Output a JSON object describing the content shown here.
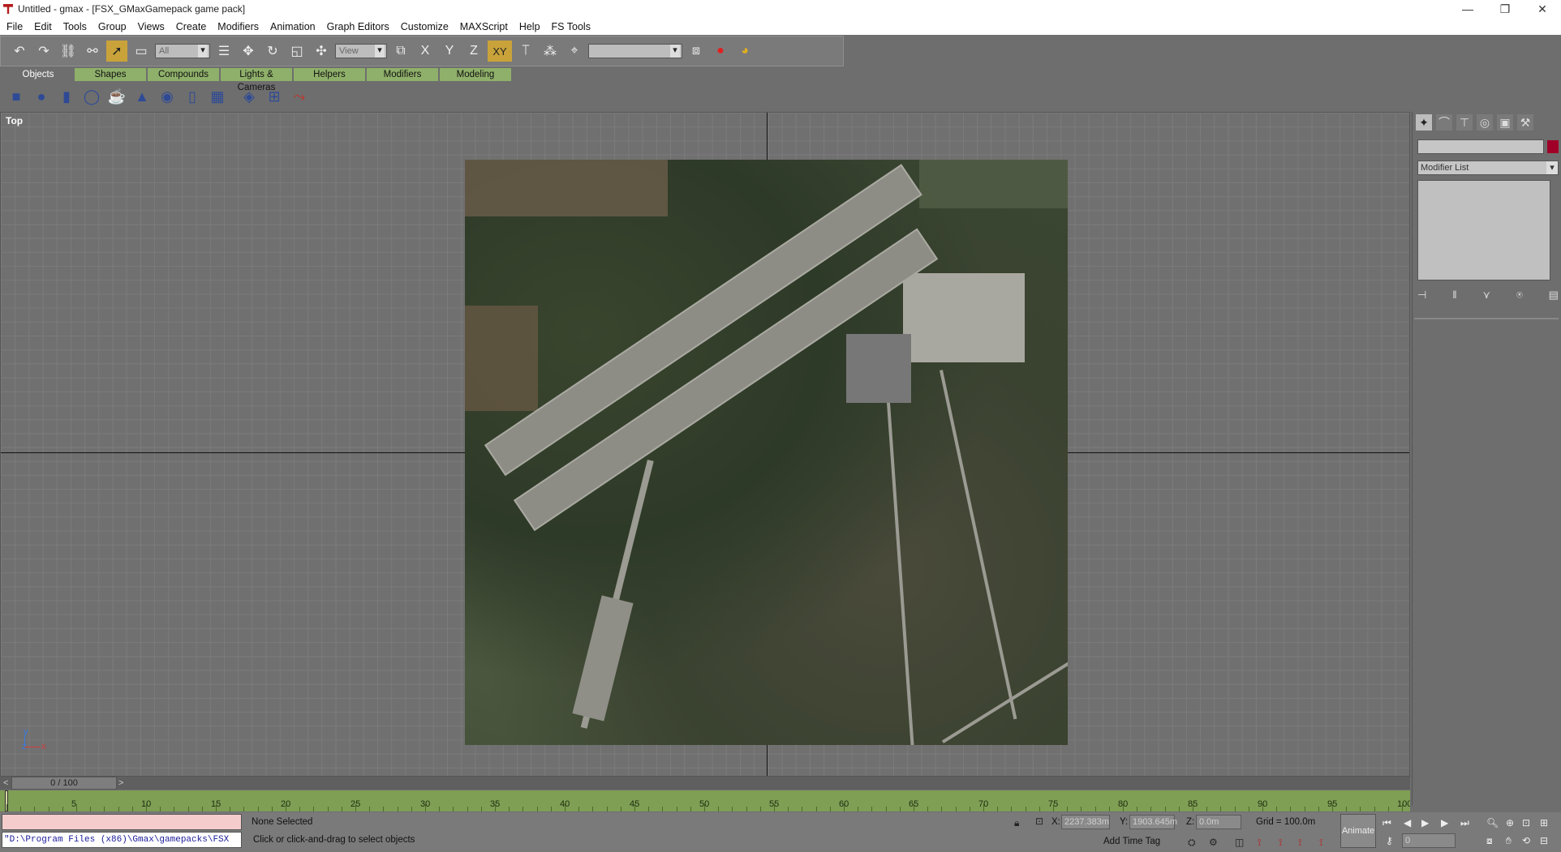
{
  "window": {
    "title": "Untitled - gmax - [FSX_GMaxGamepack game pack]",
    "controls": [
      "—",
      "❐",
      "✕"
    ]
  },
  "menu": [
    "File",
    "Edit",
    "Tools",
    "Group",
    "Views",
    "Create",
    "Modifiers",
    "Animation",
    "Graph Editors",
    "Customize",
    "MAXScript",
    "Help",
    "FS Tools"
  ],
  "toolbar": {
    "selection_filter": "All",
    "coord_system": "View",
    "axis_x": "X",
    "axis_y": "Y",
    "axis_z": "Z",
    "axis_xy": "XY",
    "named_selection": ""
  },
  "tabs": [
    "Objects",
    "Shapes",
    "Compounds",
    "Lights & Cameras",
    "Helpers",
    "Modifiers",
    "Modeling"
  ],
  "active_tab": "Objects",
  "viewport": {
    "label": "Top",
    "axis_x": "x",
    "axis_y": "y",
    "axis_z": "z"
  },
  "command_panel": {
    "object_name": "",
    "object_color": "#a00028",
    "modifier_list": "Modifier List"
  },
  "timeline": {
    "slider": "0 / 100",
    "prev": "<",
    "next": ">",
    "ticks": [
      "5",
      "10",
      "15",
      "20",
      "25",
      "30",
      "35",
      "40",
      "45",
      "50",
      "55",
      "60",
      "65",
      "70",
      "75",
      "80",
      "85",
      "90",
      "95",
      "100"
    ]
  },
  "status": {
    "listener_line": "\"D:\\Program Files (x86)\\Gmax\\gamepacks\\FSX",
    "selection": "None Selected",
    "prompt": "Click or click-and-drag to select objects",
    "x_label": "X:",
    "x_value": "2237.383m",
    "y_label": "Y:",
    "y_value": "1903.645m",
    "z_label": "Z:",
    "z_value": "0.0m",
    "grid": "Grid = 100.0m",
    "add_time_tag": "Add Time Tag",
    "animate": "Animate",
    "current_frame": "0"
  },
  "colors": {
    "accent_active": "#c9a33a",
    "tab_green": "#8fb06a",
    "trackbar_green": "#7f9f55"
  }
}
